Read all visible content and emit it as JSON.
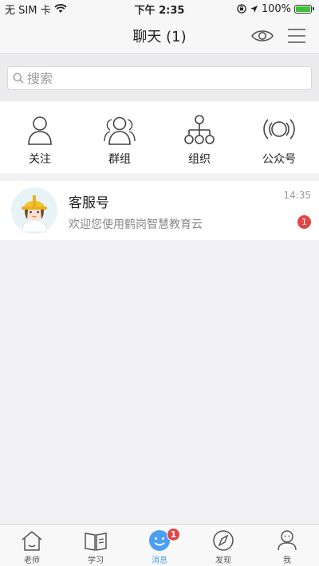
{
  "status_bar": {
    "carrier": "无 SIM 卡",
    "time": "下午 2:35",
    "battery": "100%",
    "battery_level": 1.0
  },
  "nav": {
    "title": "聊天 (1)"
  },
  "search": {
    "placeholder": "搜索"
  },
  "quick_actions": [
    {
      "label": "关注",
      "icon": "user-icon"
    },
    {
      "label": "群组",
      "icon": "group-icon"
    },
    {
      "label": "组织",
      "icon": "org-tree-icon"
    },
    {
      "label": "公众号",
      "icon": "broadcast-icon"
    }
  ],
  "conversations": [
    {
      "name": "客服号",
      "preview": "欢迎您使用鹤岗智慧教育云",
      "time": "14:35",
      "unread": "1"
    }
  ],
  "tabs": [
    {
      "label": "老师",
      "icon": "home-icon"
    },
    {
      "label": "学习",
      "icon": "book-icon"
    },
    {
      "label": "消息",
      "icon": "message-icon",
      "badge": "1",
      "active": true
    },
    {
      "label": "发现",
      "icon": "compass-icon"
    },
    {
      "label": "我",
      "icon": "profile-icon"
    }
  ],
  "colors": {
    "accent": "#4a9ff2",
    "badge": "#e34545"
  }
}
